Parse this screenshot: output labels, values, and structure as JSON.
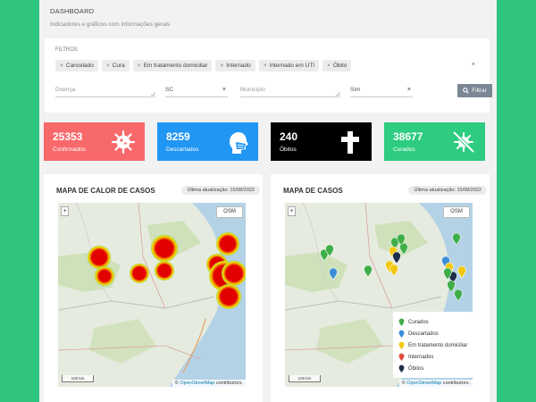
{
  "header": {
    "title": "DASHBOARD",
    "subtitle": "Indicadores e gráficos com informações gerais"
  },
  "filters": {
    "label": "FILTROS",
    "chips": [
      {
        "label": "Cancelado"
      },
      {
        "label": "Cura"
      },
      {
        "label": "Em tratamento domiciliar"
      },
      {
        "label": "Internado"
      },
      {
        "label": "Internado em UTI"
      },
      {
        "label": "Óbito"
      }
    ],
    "chip_remove": "×",
    "clear_all": "×",
    "disease_placeholder": "Doença",
    "state_value": "SC",
    "city_placeholder": "Município",
    "flag_value": "Sim",
    "button_label": "Filtrar"
  },
  "stats": [
    {
      "value": "25353",
      "label": "Confirmados",
      "color": "#f8696b",
      "icon": "virus-icon"
    },
    {
      "value": "8259",
      "label": "Descartados",
      "color": "#2196f3",
      "icon": "masked-head-icon"
    },
    {
      "value": "240",
      "label": "Óbitos",
      "color": "#000000",
      "icon": "cross-icon"
    },
    {
      "value": "38677",
      "label": "Curados",
      "color": "#2ecc80",
      "icon": "crossed-virus-icon"
    }
  ],
  "heatmap": {
    "title": "MAPA DE CALOR DE CASOS",
    "updated": "Última atualização: 15/08/2022",
    "osm": "OSM",
    "scale": "100 km",
    "attribution_prefix": "© ",
    "attribution_link": "OpenStreetMap",
    "attribution_suffix": " contributors."
  },
  "casesmap": {
    "title": "MAPA DE CASOS",
    "updated": "Última atualização: 15/08/2022",
    "osm": "OSM",
    "scale": "100 km",
    "attribution_prefix": "© ",
    "attribution_link": "OpenStreetMap",
    "attribution_suffix": " contributors.",
    "legend": [
      {
        "label": "Curados",
        "color": "#3fae49"
      },
      {
        "label": "Descartados",
        "color": "#3b8ed6"
      },
      {
        "label": "Em tratamento domiciliar",
        "color": "#f2c811"
      },
      {
        "label": "Internados",
        "color": "#e04b3c"
      },
      {
        "label": "Óbitos",
        "color": "#1d2e4a"
      }
    ]
  },
  "colors": {
    "page_bg": "#2fc57f",
    "filter_button": "#7b8794",
    "zoom_in": "+"
  }
}
